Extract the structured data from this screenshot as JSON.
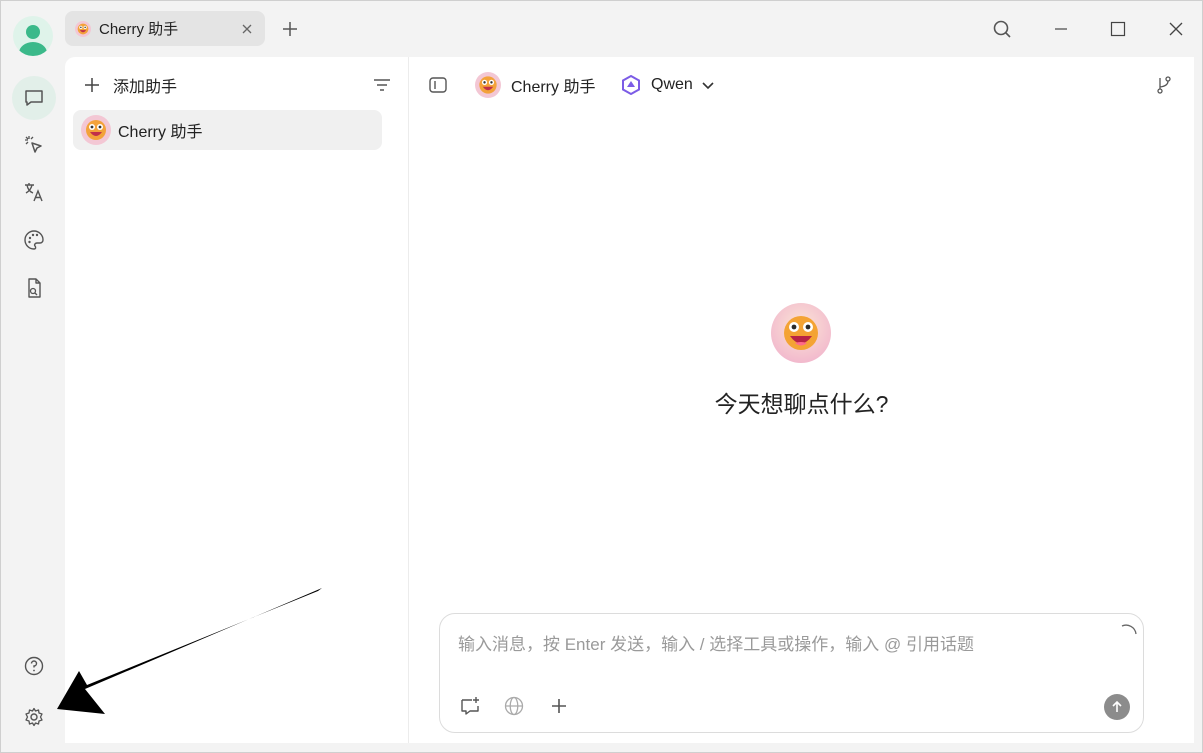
{
  "titlebar": {
    "tab_label": "Cherry 助手",
    "icons": [
      "close-icon",
      "plus-icon",
      "search-icon",
      "minimize-icon",
      "maximize-icon",
      "window-close-icon"
    ]
  },
  "sidebar": {
    "items": [
      {
        "name": "chat-icon",
        "active": true
      },
      {
        "name": "agent-pointer-icon",
        "active": false
      },
      {
        "name": "translate-icon",
        "active": false
      },
      {
        "name": "palette-icon",
        "active": false
      },
      {
        "name": "file-search-icon",
        "active": false
      }
    ],
    "bottom": [
      "help-icon",
      "settings-icon"
    ]
  },
  "assistants_panel": {
    "add_label": "添加助手",
    "items": [
      {
        "label": "Cherry 助手",
        "selected": true
      }
    ]
  },
  "chat": {
    "assistant_name": "Cherry 助手",
    "model_name": "Qwen",
    "welcome": "今天想聊点什么?",
    "input_placeholder": "输入消息，按 Enter 发送，输入 / 选择工具或操作，输入 @ 引用话题"
  },
  "colors": {
    "accent": "#3bb98a",
    "active_rail": "#e2efe9",
    "send_button": "#8c8c8c",
    "qwen_purple": "#7c5ce6"
  }
}
